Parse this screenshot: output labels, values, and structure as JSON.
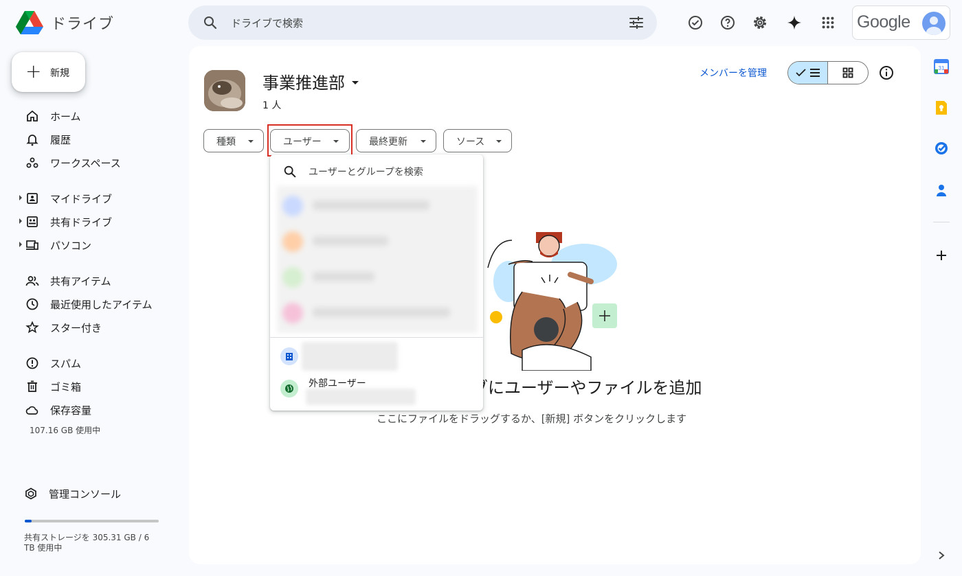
{
  "app": {
    "name": "ドライブ",
    "google_word": "Google"
  },
  "search": {
    "placeholder": "ドライブで検索"
  },
  "sidebar": {
    "new_label": "新規",
    "items": [
      {
        "label": "ホーム",
        "icon": "home-icon"
      },
      {
        "label": "履歴",
        "icon": "bell-icon"
      },
      {
        "label": "ワークスペース",
        "icon": "workspaces-icon"
      },
      {
        "label": "マイドライブ",
        "icon": "my-drive-icon"
      },
      {
        "label": "共有ドライブ",
        "icon": "shared-drive-icon"
      },
      {
        "label": "パソコン",
        "icon": "computer-icon"
      },
      {
        "label": "共有アイテム",
        "icon": "people-icon"
      },
      {
        "label": "最近使用したアイテム",
        "icon": "clock-icon"
      },
      {
        "label": "スター付き",
        "icon": "star-icon"
      },
      {
        "label": "スパム",
        "icon": "spam-icon"
      },
      {
        "label": "ゴミ箱",
        "icon": "trash-icon"
      },
      {
        "label": "保存容量",
        "icon": "cloud-icon"
      }
    ],
    "storage_used": "107.16 GB 使用中",
    "admin_console": "管理コンソール",
    "shared_storage": "共有ストレージを 305.31 GB / 6 TB 使用中",
    "shared_storage_fraction": 0.05
  },
  "drive": {
    "title": "事業推進部",
    "member_count": "1 人",
    "manage_members": "メンバーを管理"
  },
  "filters": {
    "type": "種類",
    "user": "ユーザー",
    "modified": "最終更新",
    "source": "ソース"
  },
  "dropdown": {
    "search_placeholder": "ユーザーとグループを検索",
    "external_users": "外部ユーザー"
  },
  "empty_state": {
    "title": "ブにユーザーやファイルを追加",
    "subtitle": "ここにファイルをドラッグするか、[新規] ボタンをクリックします"
  },
  "colors": {
    "accent": "#0b57d0",
    "selected": "#c2e7ff",
    "highlight": "#d93025"
  }
}
